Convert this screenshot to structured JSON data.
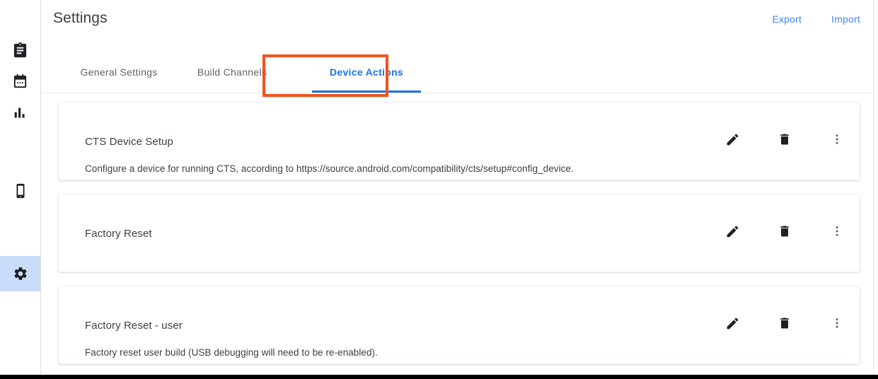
{
  "sidebar": {
    "items": [
      {
        "icon": "clipboard-icon",
        "name": "sidebar-item-tests",
        "active": false
      },
      {
        "icon": "calendar-icon",
        "name": "sidebar-item-schedules",
        "active": false
      },
      {
        "icon": "bar-chart-icon",
        "name": "sidebar-item-results",
        "active": false
      },
      {
        "icon": "smartphone-icon",
        "name": "sidebar-item-devices",
        "active": false
      },
      {
        "icon": "gear-icon",
        "name": "sidebar-item-settings",
        "active": true
      }
    ],
    "active_highlight_color": "#c9ddfb"
  },
  "header": {
    "title": "Settings",
    "export_label": "Export",
    "import_label": "Import",
    "link_color": "#4285f4"
  },
  "tabs": {
    "items": [
      {
        "label": "General Settings",
        "active": false
      },
      {
        "label": "Build Channels",
        "active": false
      },
      {
        "label": "Device Actions",
        "active": true
      }
    ],
    "active_color": "#1a73e8",
    "inactive_color": "#5f6368",
    "focus_box_color": "#f4511e"
  },
  "device_actions": [
    {
      "name": "CTS Device Setup",
      "description": "Configure a device for running CTS, according to https://source.android.com/compatibility/cts/setup#config_device.",
      "actions": [
        "edit-icon",
        "delete-icon",
        "more-vert-icon"
      ]
    },
    {
      "name": "Factory Reset",
      "description": "",
      "actions": [
        "edit-icon",
        "delete-icon",
        "more-vert-icon"
      ]
    },
    {
      "name": "Factory Reset - user",
      "description": "Factory reset user build (USB debugging will need to be re-enabled).",
      "actions": [
        "edit-icon",
        "delete-icon",
        "more-vert-icon"
      ]
    }
  ]
}
